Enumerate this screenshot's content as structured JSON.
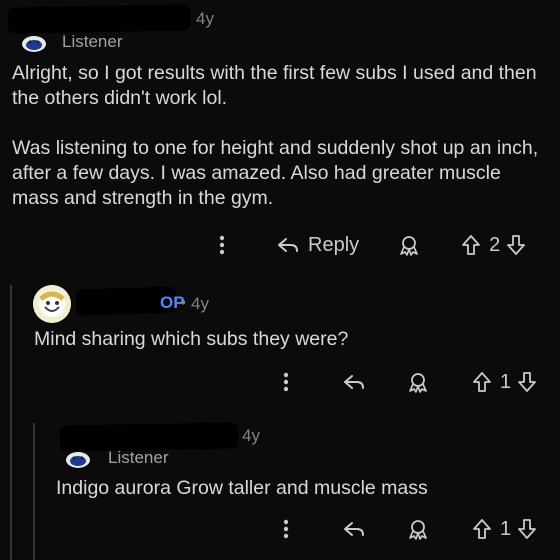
{
  "comment1": {
    "age": "4y",
    "flair": "Listener",
    "paragraphs": [
      "Alright, so I got results with the first few subs I used and then the others didn't work lol.",
      "Was listening to one for height and suddenly shot up an inch, after a few days. I was amazed. Also had greater muscle mass and strength in the gym."
    ],
    "reply_label": "Reply",
    "vote_count": "2"
  },
  "comment2": {
    "op_tag": "OP",
    "dot": "•",
    "age": "4y",
    "text": "Mind sharing which subs they were?",
    "vote_count": "1"
  },
  "comment3": {
    "age": "4y",
    "flair": "Listener",
    "text": "Indigo aurora Grow taller and muscle mass",
    "vote_count": "1"
  },
  "icons": {
    "more": "more-vertical-icon",
    "reply": "reply-arrow-icon",
    "award": "award-icon",
    "upvote": "upvote-arrow-icon",
    "downvote": "downvote-arrow-icon"
  },
  "colors": {
    "background": "#0b0b0b",
    "text": "#d7dadc",
    "meta": "#818384",
    "op": "#4a8cff",
    "thread_line": "#343536"
  }
}
